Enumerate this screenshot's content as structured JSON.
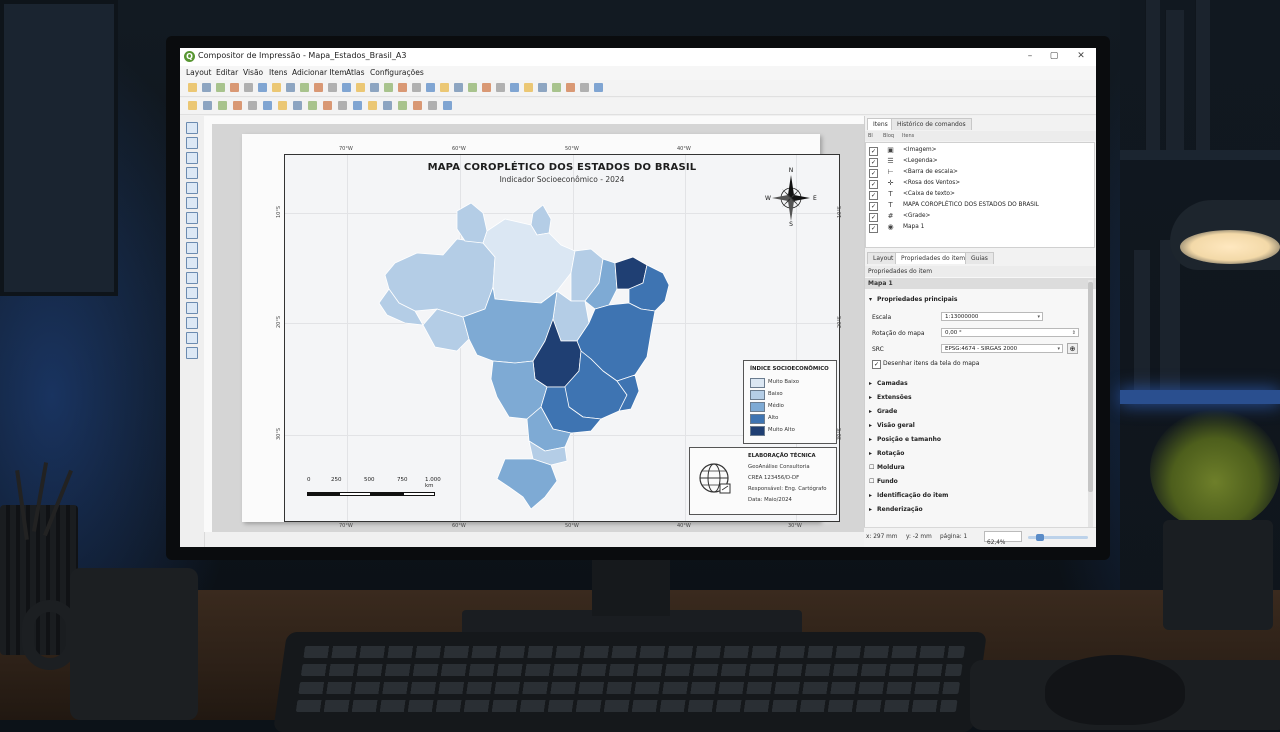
{
  "window": {
    "title": "Compositor de Impressão - Mapa_Estados_Brasil_A3",
    "controls": {
      "minimize": "–",
      "maximize": "▢",
      "close": "✕"
    }
  },
  "menu": [
    "Layout",
    "Editar",
    "Visão",
    "Itens",
    "Adicionar Item",
    "Atlas",
    "Configurações"
  ],
  "map": {
    "title": "MAPA COROPLÉTICO DOS ESTADOS DO BRASIL",
    "subtitle": "Indicador Socioeconômico - 2024",
    "lon_labels": [
      "70°W",
      "60°W",
      "50°W",
      "40°W",
      "30°W"
    ],
    "lat_labels": [
      "10°S",
      "10°S",
      "20°S",
      "30°S"
    ],
    "north_arrow": {
      "n": "N",
      "s": "S",
      "e": "E",
      "w": "W"
    },
    "legend": {
      "title": "ÍNDICE SOCIOECONÔMICO",
      "classes": [
        {
          "label": "Muito Baixo",
          "color": "#dbe7f3"
        },
        {
          "label": "Baixo",
          "color": "#b4cde6"
        },
        {
          "label": "Médio",
          "color": "#7eaad4"
        },
        {
          "label": "Alto",
          "color": "#3e74b2"
        },
        {
          "label": "Muito Alto",
          "color": "#1f3f73"
        }
      ]
    },
    "scalebar": {
      "labels": [
        "0",
        "250",
        "500",
        "750",
        "1.000 km"
      ]
    },
    "tech": {
      "title": "ELABORAÇÃO TÉCNICA",
      "company": "GeoAnálise Consultoria",
      "crea": "CREA 123456/D-DF",
      "responsible": "Responsável: Eng. Cartógrafo",
      "date": "Data: Maio/2024"
    }
  },
  "items_panel": {
    "tabs": [
      "Itens",
      "Histórico de comandos"
    ],
    "columns": [
      "Bl",
      "Bloq",
      "Itens"
    ],
    "items": [
      {
        "name": "<Imagem>",
        "icon": "image-icon",
        "glyph": "▣"
      },
      {
        "name": "<Legenda>",
        "icon": "legend-icon",
        "glyph": "☰"
      },
      {
        "name": "<Barra de escala>",
        "icon": "scalebar-icon",
        "glyph": "⊢"
      },
      {
        "name": "<Rosa dos Ventos>",
        "icon": "compass-icon",
        "glyph": "✛"
      },
      {
        "name": "<Caixa de texto>",
        "icon": "textbox-icon",
        "glyph": "T"
      },
      {
        "name": "MAPA COROPLÉTICO DOS ESTADOS DO BRASIL",
        "icon": "label-icon",
        "glyph": "T"
      },
      {
        "name": "<Grade>",
        "icon": "grid-icon",
        "glyph": "#"
      },
      {
        "name": "Mapa 1",
        "icon": "map-icon",
        "glyph": "◉"
      }
    ]
  },
  "props_panel": {
    "tabs": [
      "Layout",
      "Propriedades do item",
      "Guias"
    ],
    "header": "Propriedades do item",
    "item_name": "Mapa 1",
    "main_section": "Propriedades principais",
    "scale_label": "Escala",
    "scale_value": "1:13000000",
    "rotation_label": "Rotação do mapa",
    "rotation_value": "0,00 °",
    "crs_label": "SRC",
    "crs_value": "EPSG:4674 - SIRGAS 2000",
    "draw_checkbox_label": "Desenhar itens da tela do mapa",
    "sections": [
      "Camadas",
      "Extensões",
      "Grade",
      "Visão geral",
      "Posição e tamanho",
      "Rotação",
      "Moldura",
      "Fundo",
      "Identificação do item",
      "Renderização"
    ]
  },
  "status": {
    "x": "x: 297 mm",
    "y": "y: -2 mm",
    "page": "página: 1",
    "zoom": "62,4%"
  }
}
